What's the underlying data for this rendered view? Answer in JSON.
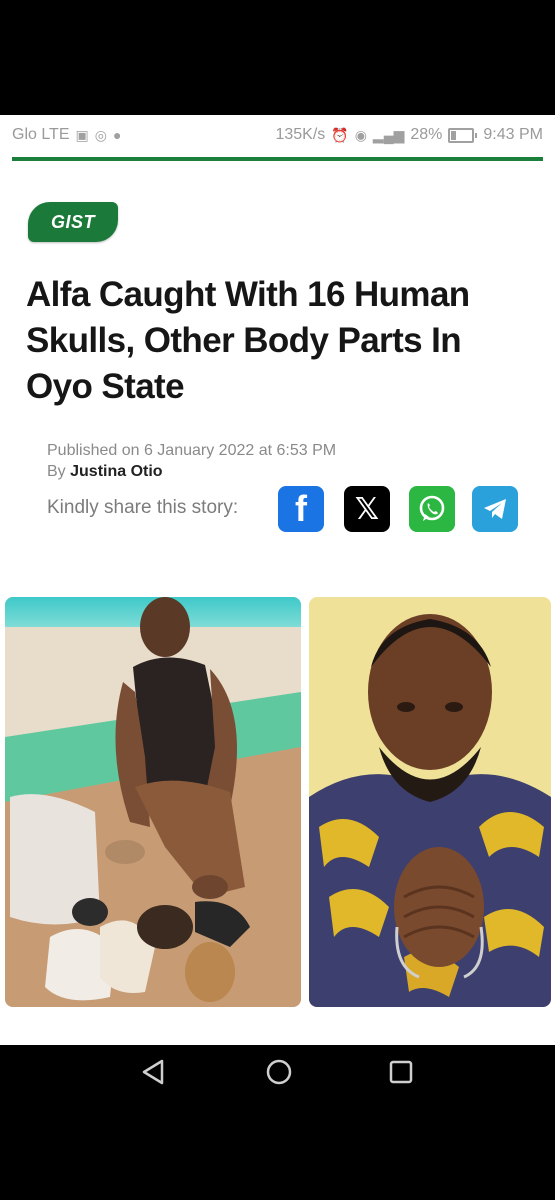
{
  "status_bar": {
    "carrier": "Glo LTE",
    "speed": "135K/s",
    "battery": "28%",
    "battery_level": 0.28,
    "time": "9:43 PM"
  },
  "article": {
    "category": "GIST",
    "title": "Alfa Caught With 16 Human Skulls, Other Body Parts In Oyo State",
    "published": "Published on 6 January 2022 at 6:53 PM",
    "by_prefix": "By",
    "author": "Justina Otio",
    "share_label": "Kindly share this story:"
  },
  "share_buttons": [
    {
      "name": "facebook",
      "icon": "facebook-icon",
      "glyph": "f"
    },
    {
      "name": "x",
      "icon": "x-icon",
      "glyph": "𝕏"
    },
    {
      "name": "whatsapp",
      "icon": "whatsapp-icon"
    },
    {
      "name": "telegram",
      "icon": "telegram-icon"
    }
  ],
  "colors": {
    "accent": "#1b7a3a",
    "facebook": "#1b74e4",
    "whatsapp": "#2bb741",
    "telegram": "#2aa1db"
  }
}
